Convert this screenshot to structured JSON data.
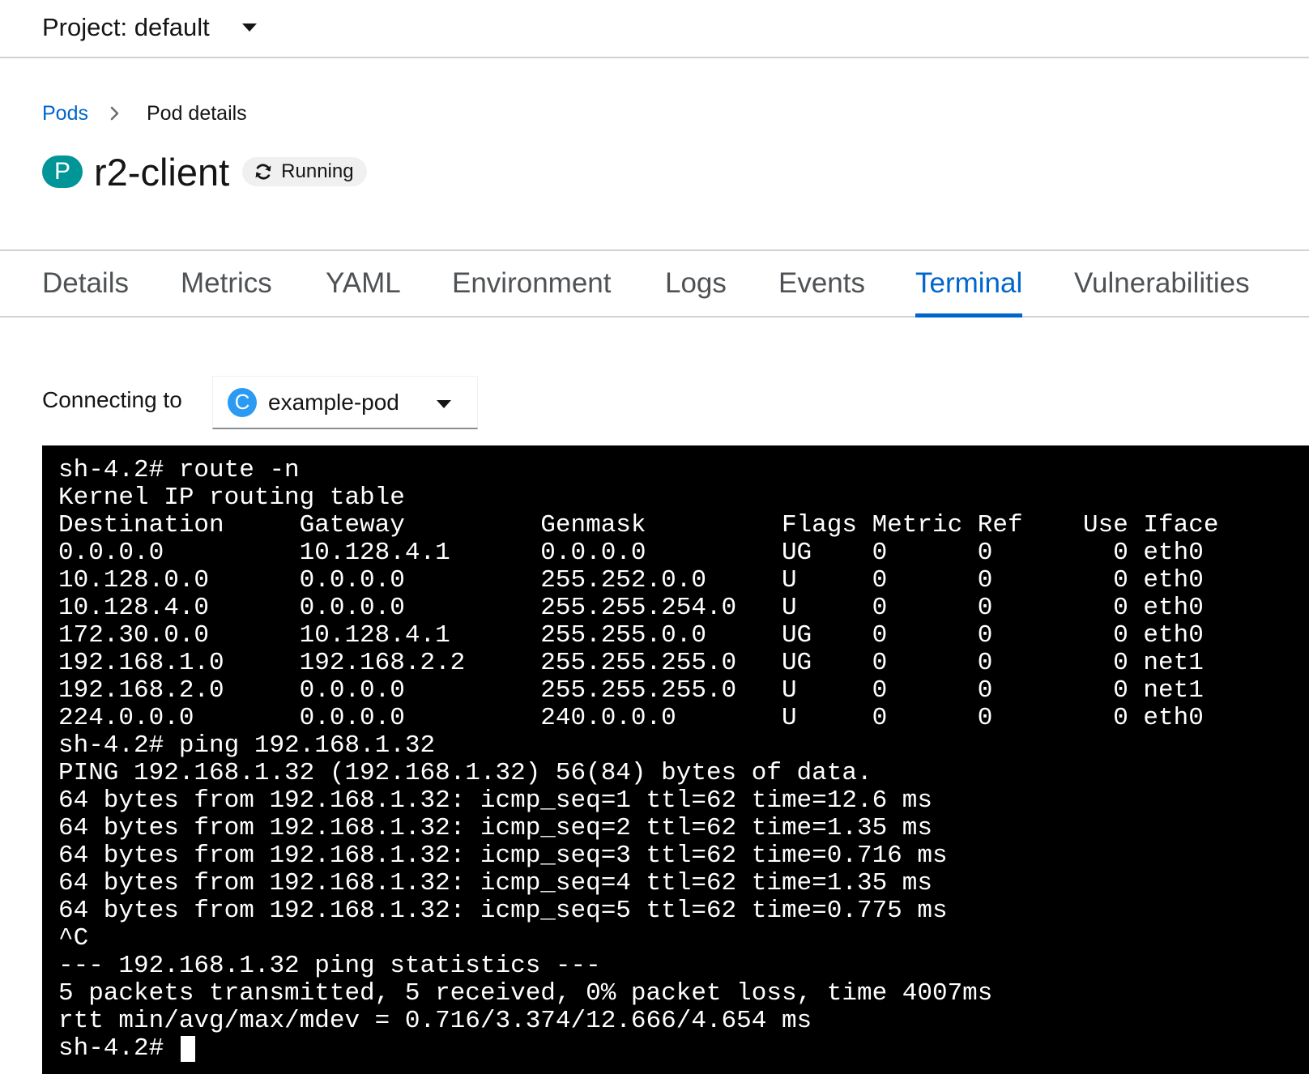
{
  "project": {
    "label": "Project: default"
  },
  "breadcrumb": {
    "parent": "Pods",
    "current": "Pod details"
  },
  "pod": {
    "badge": "P",
    "name": "r2-client",
    "status": "Running"
  },
  "tabs": [
    {
      "label": "Details"
    },
    {
      "label": "Metrics"
    },
    {
      "label": "YAML"
    },
    {
      "label": "Environment"
    },
    {
      "label": "Logs"
    },
    {
      "label": "Events"
    },
    {
      "label": "Terminal",
      "active": true
    },
    {
      "label": "Vulnerabilities"
    }
  ],
  "connect": {
    "label": "Connecting to",
    "container_badge": "C",
    "container_name": "example-pod"
  },
  "terminal": {
    "output": "sh-4.2# route -n\nKernel IP routing table\nDestination     Gateway         Genmask         Flags Metric Ref    Use Iface\n0.0.0.0         10.128.4.1      0.0.0.0         UG    0      0        0 eth0\n10.128.0.0      0.0.0.0         255.252.0.0     U     0      0        0 eth0\n10.128.4.0      0.0.0.0         255.255.254.0   U     0      0        0 eth0\n172.30.0.0      10.128.4.1      255.255.0.0     UG    0      0        0 eth0\n192.168.1.0     192.168.2.2     255.255.255.0   UG    0      0        0 net1\n192.168.2.0     0.0.0.0         255.255.255.0   U     0      0        0 net1\n224.0.0.0       0.0.0.0         240.0.0.0       U     0      0        0 eth0\nsh-4.2# ping 192.168.1.32\nPING 192.168.1.32 (192.168.1.32) 56(84) bytes of data.\n64 bytes from 192.168.1.32: icmp_seq=1 ttl=62 time=12.6 ms\n64 bytes from 192.168.1.32: icmp_seq=2 ttl=62 time=1.35 ms\n64 bytes from 192.168.1.32: icmp_seq=3 ttl=62 time=0.716 ms\n64 bytes from 192.168.1.32: icmp_seq=4 ttl=62 time=1.35 ms\n64 bytes from 192.168.1.32: icmp_seq=5 ttl=62 time=0.775 ms\n^C\n--- 192.168.1.32 ping statistics ---\n5 packets transmitted, 5 received, 0% packet loss, time 4007ms\nrtt min/avg/max/mdev = 0.716/3.374/12.666/4.654 ms",
    "prompt": "sh-4.2# "
  },
  "colors": {
    "link": "#0066cc",
    "pod_badge": "#009596",
    "container_badge": "#2b9af3",
    "terminal_bg": "#000000",
    "terminal_fg": "#ffffff"
  },
  "icons": {
    "project_toggle": "caret-down-icon",
    "breadcrumb_separator": "angle-right-icon",
    "status": "sync-icon",
    "container_toggle": "caret-down-icon"
  }
}
